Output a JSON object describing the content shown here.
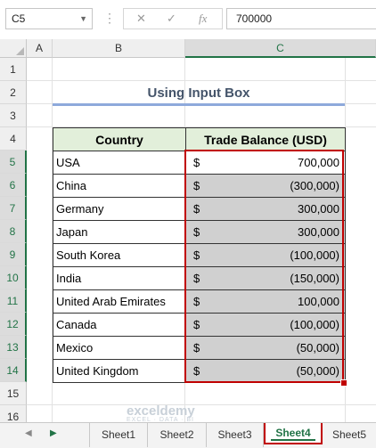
{
  "formula_bar": {
    "name_box": "C5",
    "cancel_icon": "✕",
    "enter_icon": "✓",
    "fx_label": "fx",
    "formula_value": "700000"
  },
  "columns": [
    "A",
    "B",
    "C"
  ],
  "rows": [
    "1",
    "2",
    "3",
    "4",
    "5",
    "6",
    "7",
    "8",
    "9",
    "10",
    "11",
    "12",
    "13",
    "14",
    "15",
    "16"
  ],
  "sheet": {
    "title": "Using Input Box",
    "headers": {
      "country": "Country",
      "balance": "Trade Balance (USD)"
    },
    "currency_symbol": "$",
    "records": [
      {
        "country": "USA",
        "balance": "700,000"
      },
      {
        "country": "China",
        "balance": "(300,000)"
      },
      {
        "country": "Germany",
        "balance": "300,000"
      },
      {
        "country": "Japan",
        "balance": "300,000"
      },
      {
        "country": "South Korea",
        "balance": "(100,000)"
      },
      {
        "country": "India",
        "balance": "(150,000)"
      },
      {
        "country": "United Arab Emirates",
        "balance": "100,000"
      },
      {
        "country": "Canada",
        "balance": "(100,000)"
      },
      {
        "country": "Mexico",
        "balance": "(50,000)"
      },
      {
        "country": "United Kingdom",
        "balance": "(50,000)"
      }
    ]
  },
  "tabs": [
    "Sheet1",
    "Sheet2",
    "Sheet3",
    "Sheet4",
    "Sheet5"
  ],
  "active_tab": "Sheet4",
  "watermark": {
    "name": "exceldemy",
    "tagline": "EXCEL · DATA · BI"
  },
  "colors": {
    "accent": "#217346",
    "highlight_border": "#c00000",
    "header_fill": "#e2efda",
    "selection_fill": "#d0d0d0"
  }
}
